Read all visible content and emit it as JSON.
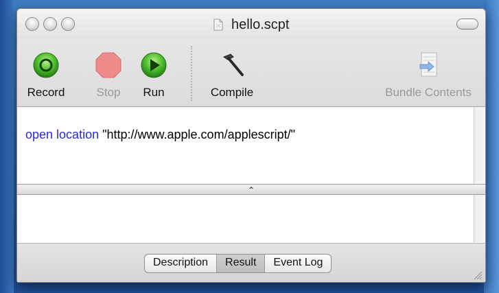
{
  "window": {
    "title": "hello.scpt"
  },
  "toolbar": {
    "record_label": "Record",
    "stop_label": "Stop",
    "run_label": "Run",
    "compile_label": "Compile",
    "bundle_label": "Bundle Contents"
  },
  "editor": {
    "keyword": "open location",
    "string_literal": " \"http://www.apple.com/applescript/\""
  },
  "tabs": [
    {
      "label": "Description"
    },
    {
      "label": "Result",
      "selected": true
    },
    {
      "label": "Event Log"
    }
  ],
  "colors": {
    "keyword": "#2a2ad6",
    "record_green": "#3aa83a",
    "stop_red": "#e87878",
    "run_green": "#3aa83a"
  },
  "icons": {
    "record": "record-icon",
    "stop": "stop-icon",
    "run": "run-icon",
    "compile": "hammer-icon",
    "bundle": "bundle-contents-icon",
    "document": "document-icon"
  }
}
